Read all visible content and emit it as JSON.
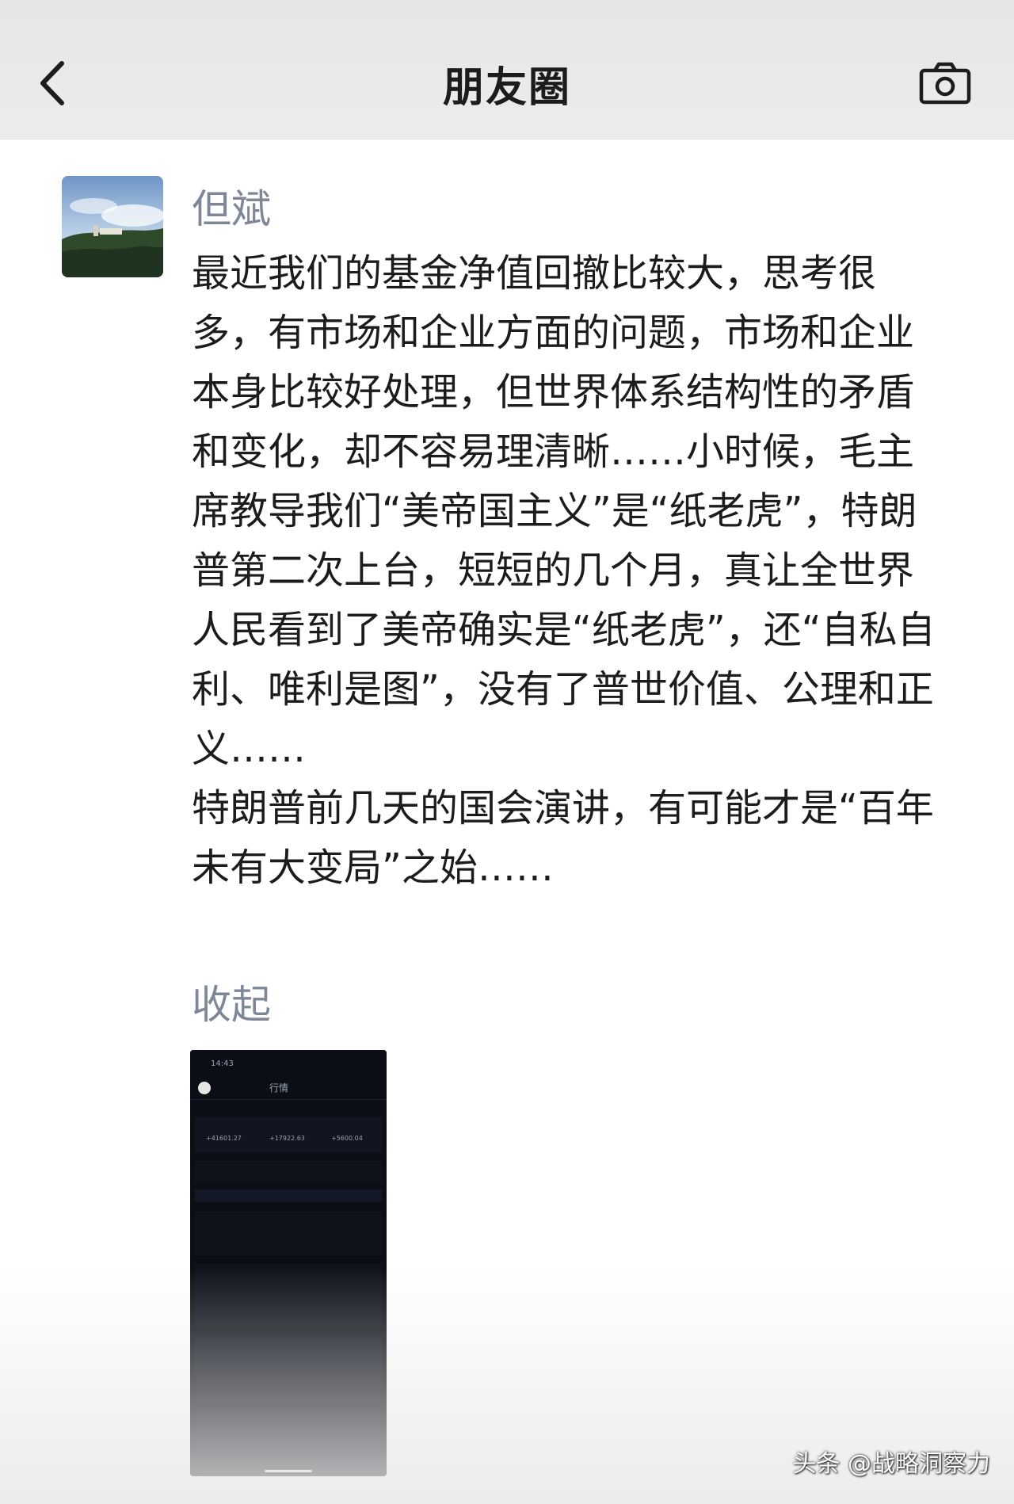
{
  "header": {
    "title": "朋友圈",
    "back_icon": "chevron-left-icon",
    "camera_icon": "camera-icon"
  },
  "post": {
    "author": "但斌",
    "paragraphs": [
      "最近我们的基金净值回撤比较大，思考很多，有市场和企业方面的问题，市场和企业本身比较好处理，但世界体系结构性的矛盾和变化，却不容易理清晰……小时候，毛主席教导我们“美帝国主义”是“纸老虎”，特朗普第二次上台，短短的几个月，真让全世界人民看到了美帝确实是“纸老虎”，还“自私自利、唯利是图”，没有了普世价值、公理和正义……",
      "特朗普前几天的国会演讲，有可能才是“百年未有大变局”之始……"
    ],
    "collapse_label": "收起"
  },
  "thumbnail": {
    "time": "14:43",
    "tab_active": "行情",
    "index_values": [
      "+41601.27",
      "+17922.63",
      "+5600.04"
    ]
  },
  "watermark": "头条 @战略洞察力",
  "colors": {
    "author_blue": "#7e8798",
    "text": "#1c1c1c",
    "header_bg": "#e6e6e6"
  }
}
